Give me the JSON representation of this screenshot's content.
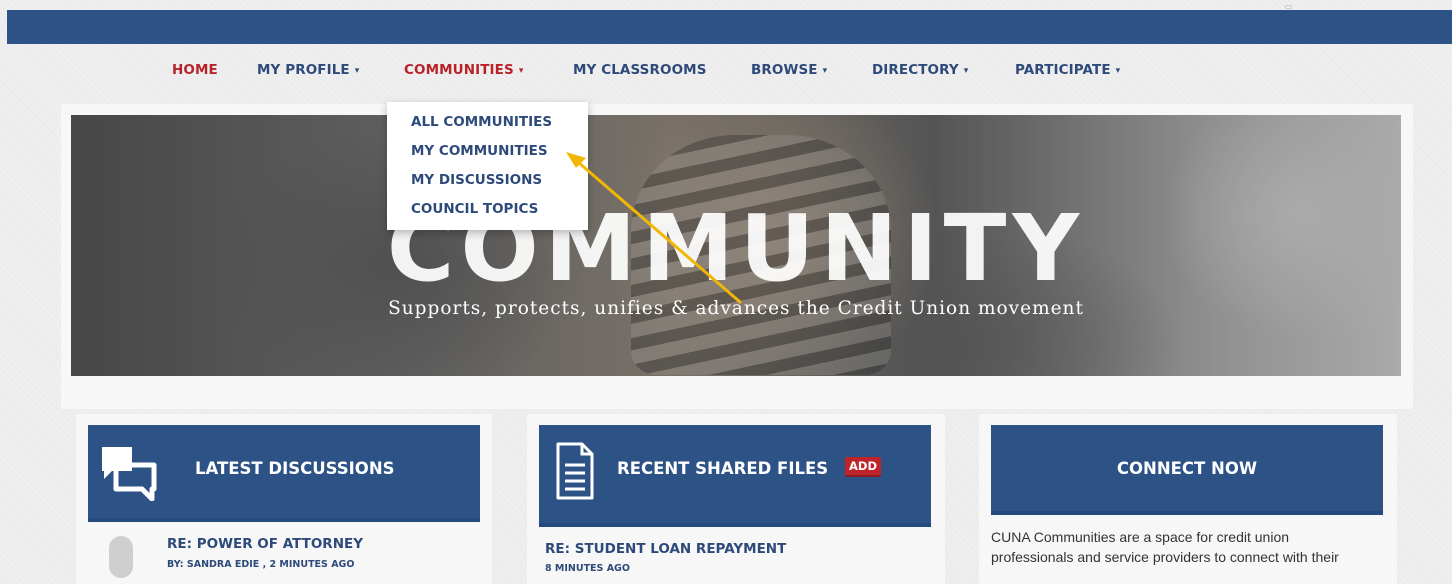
{
  "nav": {
    "items": [
      {
        "label": "HOME",
        "caret": ""
      },
      {
        "label": "MY PROFILE",
        "caret": "▾"
      },
      {
        "label": "COMMUNITIES",
        "caret": "▾"
      },
      {
        "label": "MY CLASSROOMS",
        "caret": ""
      },
      {
        "label": "BROWSE",
        "caret": "▾"
      },
      {
        "label": "DIRECTORY",
        "caret": "▾"
      },
      {
        "label": "PARTICIPATE",
        "caret": "▾"
      }
    ]
  },
  "dropdown": {
    "items": [
      {
        "label": "ALL COMMUNITIES"
      },
      {
        "label": "MY COMMUNITIES"
      },
      {
        "label": "MY DISCUSSIONS"
      },
      {
        "label": "COUNCIL TOPICS"
      }
    ]
  },
  "hero": {
    "title": "COMMUNITY",
    "subtitle": "Supports, protects, unifies & advances the Credit Union movement"
  },
  "latest_discussions": {
    "title": "LATEST DISCUSSIONS",
    "icon": "chat-bubbles-icon",
    "item_title": "RE: POWER OF ATTORNEY",
    "item_meta": "BY: SANDRA EDIE , 2 MINUTES AGO"
  },
  "recent_files": {
    "title": "RECENT SHARED FILES",
    "badge": "ADD",
    "icon": "document-icon",
    "item_title": "RE: STUDENT LOAN REPAYMENT",
    "item_meta": "8 MINUTES AGO"
  },
  "connect": {
    "title": "CONNECT NOW",
    "text_line1": "CUNA Communities are a space for credit union",
    "text_line2": "professionals and service providers to connect with their"
  },
  "colors": {
    "brand_blue": "#2d5286",
    "nav_text": "#2d4a7a",
    "active_red": "#b8232a",
    "badge_red": "#c0242b",
    "annotation_arrow": "#f2b705"
  }
}
